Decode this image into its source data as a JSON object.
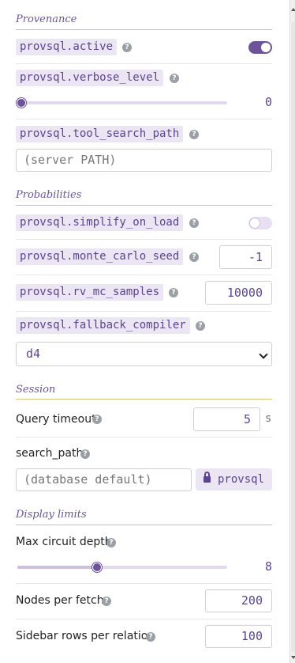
{
  "sections": {
    "provenance": "Provenance",
    "probabilities": "Probabilities",
    "session": "Session",
    "display_limits": "Display limits"
  },
  "help_icon": "?",
  "provenance": {
    "active": {
      "label": "provsql.active",
      "enabled": true
    },
    "verbose_level": {
      "label": "provsql.verbose_level",
      "value": "0",
      "fraction": 0
    },
    "tool_search_path": {
      "label": "provsql.tool_search_path",
      "placeholder": "(server PATH)"
    }
  },
  "probabilities": {
    "simplify_on_load": {
      "label": "provsql.simplify_on_load",
      "enabled": false
    },
    "monte_carlo_seed": {
      "label": "provsql.monte_carlo_seed",
      "value": "-1"
    },
    "rv_mc_samples": {
      "label": "provsql.rv_mc_samples",
      "value": "10000"
    },
    "fallback_compiler": {
      "label": "provsql.fallback_compiler",
      "selected": "d4"
    }
  },
  "session": {
    "query_timeout": {
      "label": "Query timeout",
      "value": "5",
      "unit": "s"
    },
    "search_path": {
      "label": "search_path",
      "placeholder": "(database default)",
      "locked_value": "provsql"
    }
  },
  "display_limits": {
    "max_circuit_depth": {
      "label": "Max circuit depth",
      "value": "8",
      "fraction": 0.38
    },
    "nodes_per_fetch": {
      "label": "Nodes per fetch",
      "value": "200"
    },
    "sidebar_rows": {
      "label": "Sidebar rows per relation",
      "value": "100"
    }
  },
  "colors": {
    "accent": "#6d5399",
    "pill_bg": "#ece5f4",
    "section_rule": "#d8c37a"
  },
  "icons": [
    "help-icon",
    "lock-icon",
    "chevron-down-icon"
  ]
}
